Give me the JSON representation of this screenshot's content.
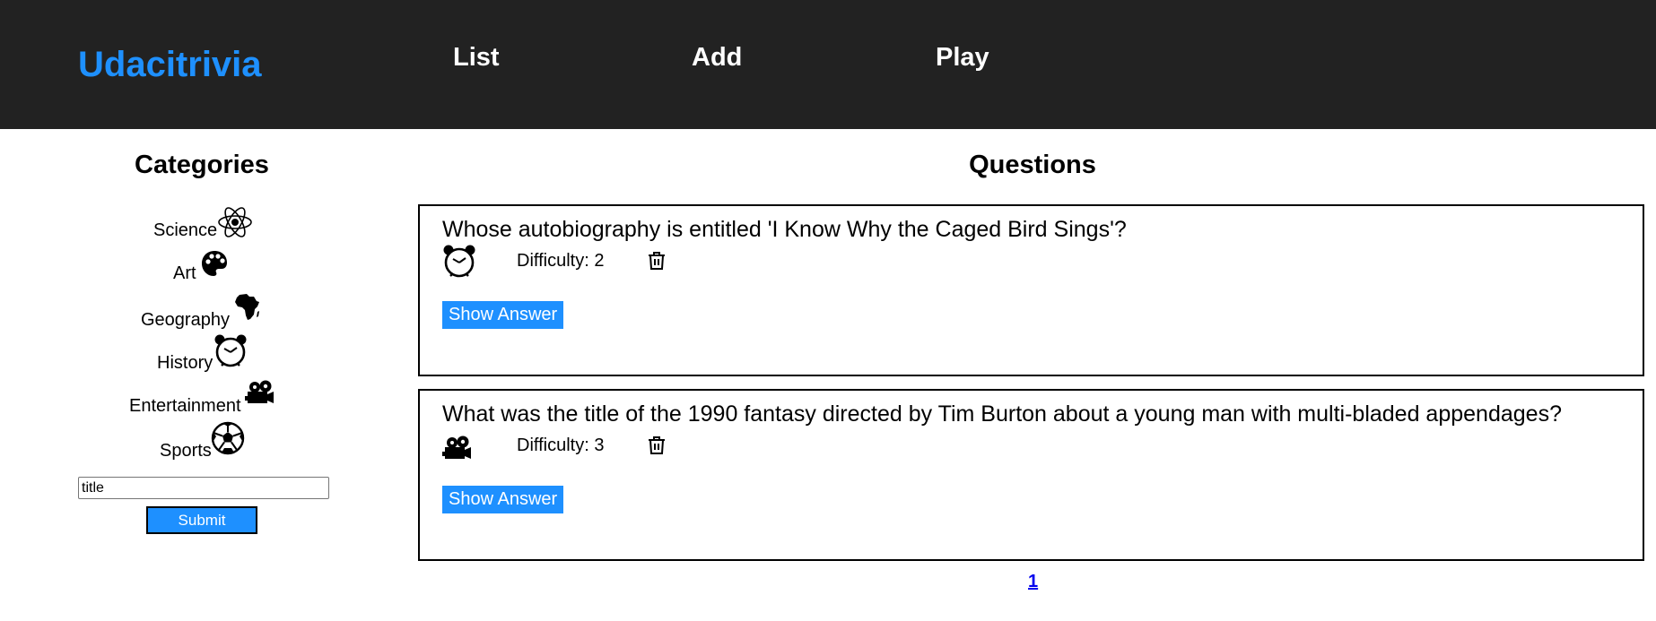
{
  "header": {
    "brand": "Udacitrivia",
    "nav": [
      "List",
      "Add",
      "Play"
    ]
  },
  "sidebar": {
    "title": "Categories",
    "categories": [
      {
        "label": "Science",
        "icon": "science-atom-icon"
      },
      {
        "label": "Art",
        "icon": "art-palette-icon"
      },
      {
        "label": "Geography",
        "icon": "geography-africa-icon"
      },
      {
        "label": "History",
        "icon": "history-clock-icon"
      },
      {
        "label": "Entertainment",
        "icon": "entertainment-projector-icon"
      },
      {
        "label": "Sports",
        "icon": "sports-ball-icon"
      }
    ],
    "search_value": "title",
    "submit_label": "Submit"
  },
  "main": {
    "title": "Questions",
    "questions": [
      {
        "text": "Whose autobiography is entitled 'I Know Why the Caged Bird Sings'?",
        "category_icon": "history-clock-icon",
        "difficulty": "Difficulty: 2",
        "show_answer_label": "Show Answer"
      },
      {
        "text": "What was the title of the 1990 fantasy directed by Tim Burton about a young man with multi-bladed appendages?",
        "category_icon": "entertainment-projector-icon",
        "difficulty": "Difficulty: 3",
        "show_answer_label": "Show Answer"
      }
    ],
    "pagination": [
      "1"
    ]
  },
  "colors": {
    "header_bg": "#222222",
    "accent": "#1e90ff",
    "link": "#0000ee"
  }
}
